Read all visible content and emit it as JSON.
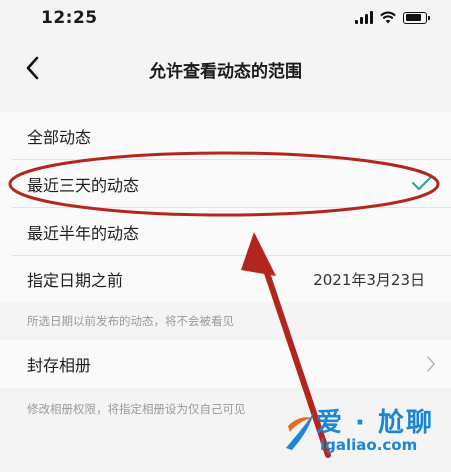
{
  "status_bar": {
    "time": "12:25"
  },
  "nav": {
    "title": "允许查看动态的范围"
  },
  "options": [
    {
      "label": "全部动态"
    },
    {
      "label": "最近三天的动态",
      "selected": true
    },
    {
      "label": "最近半年的动态"
    }
  ],
  "date_row": {
    "label": "指定日期之前",
    "value": "2021年3月23日"
  },
  "date_hint": "所选日期以前发布的动态，将不会被看见",
  "album_row": {
    "label": "封存相册"
  },
  "album_hint": "修改相册权限，将指定相册设为仅自己可见",
  "watermark": {
    "brand": "爱 · 尬聊",
    "url": "igaliao.com"
  },
  "colors": {
    "accent_check": "#2aa198",
    "annotation_red": "#b3261e",
    "watermark_blue": "#1b86d6"
  }
}
